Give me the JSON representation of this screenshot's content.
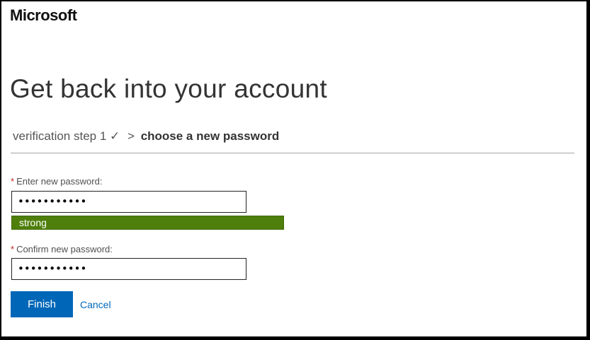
{
  "brand": {
    "name": "Microsoft"
  },
  "page": {
    "title": "Get back into your account"
  },
  "steps": {
    "completed_step": "verification step 1",
    "checkmark": "✓",
    "separator": ">",
    "current_step": "choose a new password"
  },
  "form": {
    "new_password": {
      "required_marker": "*",
      "label": "Enter new password:",
      "value": "•••••••••••"
    },
    "strength": {
      "label": "strong",
      "color": "#4f7f0b"
    },
    "confirm_password": {
      "required_marker": "*",
      "label": "Confirm new password:",
      "value": "•••••••••••"
    }
  },
  "actions": {
    "finish_label": "Finish",
    "cancel_label": "Cancel"
  },
  "colors": {
    "primary": "#0067b8",
    "required": "#c02020",
    "strength_strong": "#4f7f0b"
  }
}
